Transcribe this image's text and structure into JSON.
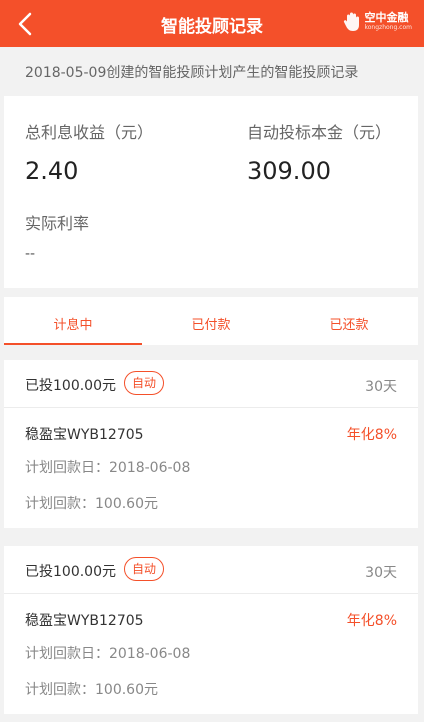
{
  "header": {
    "title": "智能投顾记录",
    "brand_name": "空中金融",
    "brand_url": "kongzhong.com"
  },
  "note": "2018-05-09创建的智能投顾计划产生的智能投顾记录",
  "summary": {
    "interest_label": "总利息收益（元）",
    "interest_value": "2.40",
    "principal_label": "自动投标本金（元）",
    "principal_value": "309.00",
    "rate_label": "实际利率",
    "rate_value": "--"
  },
  "tabs": [
    {
      "label": "计息中",
      "active": true
    },
    {
      "label": "已付款",
      "active": false
    },
    {
      "label": "已还款",
      "active": false
    }
  ],
  "records": [
    {
      "amount": "已投100.00元",
      "badge": "自动",
      "days": "30天",
      "product": "稳盈宝WYB12705",
      "rate": "年化8%",
      "return_date": "计划回款日：2018-06-08",
      "return_amount": "计划回款：100.60元"
    },
    {
      "amount": "已投100.00元",
      "badge": "自动",
      "days": "30天",
      "product": "稳盈宝WYB12705",
      "rate": "年化8%",
      "return_date": "计划回款日：2018-06-08",
      "return_amount": "计划回款：100.60元"
    }
  ],
  "colors": {
    "accent": "#f4502a",
    "background": "#f2f2f2"
  }
}
